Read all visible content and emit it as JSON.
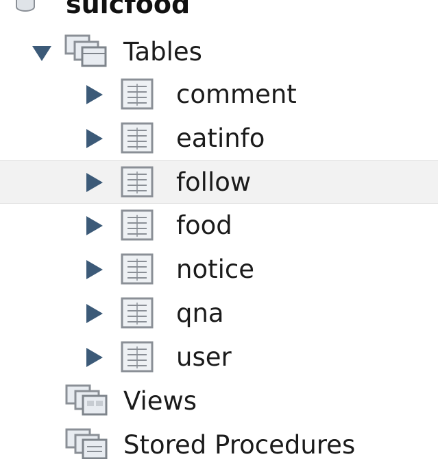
{
  "navigator": {
    "schema": {
      "name": "sulcfood",
      "icon": "database-icon"
    },
    "tables_node": {
      "label": "Tables",
      "icon": "tables-folder-icon",
      "expanded": true,
      "items": [
        {
          "label": "comment",
          "icon": "table-icon",
          "expanded": false
        },
        {
          "label": "eatinfo",
          "icon": "table-icon",
          "expanded": false
        },
        {
          "label": "follow",
          "icon": "table-icon",
          "expanded": false,
          "selected": true
        },
        {
          "label": "food",
          "icon": "table-icon",
          "expanded": false
        },
        {
          "label": "notice",
          "icon": "table-icon",
          "expanded": false
        },
        {
          "label": "qna",
          "icon": "table-icon",
          "expanded": false
        },
        {
          "label": "user",
          "icon": "table-icon",
          "expanded": false
        }
      ]
    },
    "views_node": {
      "label": "Views",
      "icon": "views-folder-icon"
    },
    "procedures_node": {
      "label": "Stored Procedures",
      "icon": "procedures-folder-icon"
    }
  },
  "colors": {
    "text": "#1b1b1b",
    "arrow": "#3c5a78",
    "selected_row_bg": "#f2f2f2",
    "icon_border": "#8a8f96",
    "icon_fill": "#e8ecf1"
  }
}
